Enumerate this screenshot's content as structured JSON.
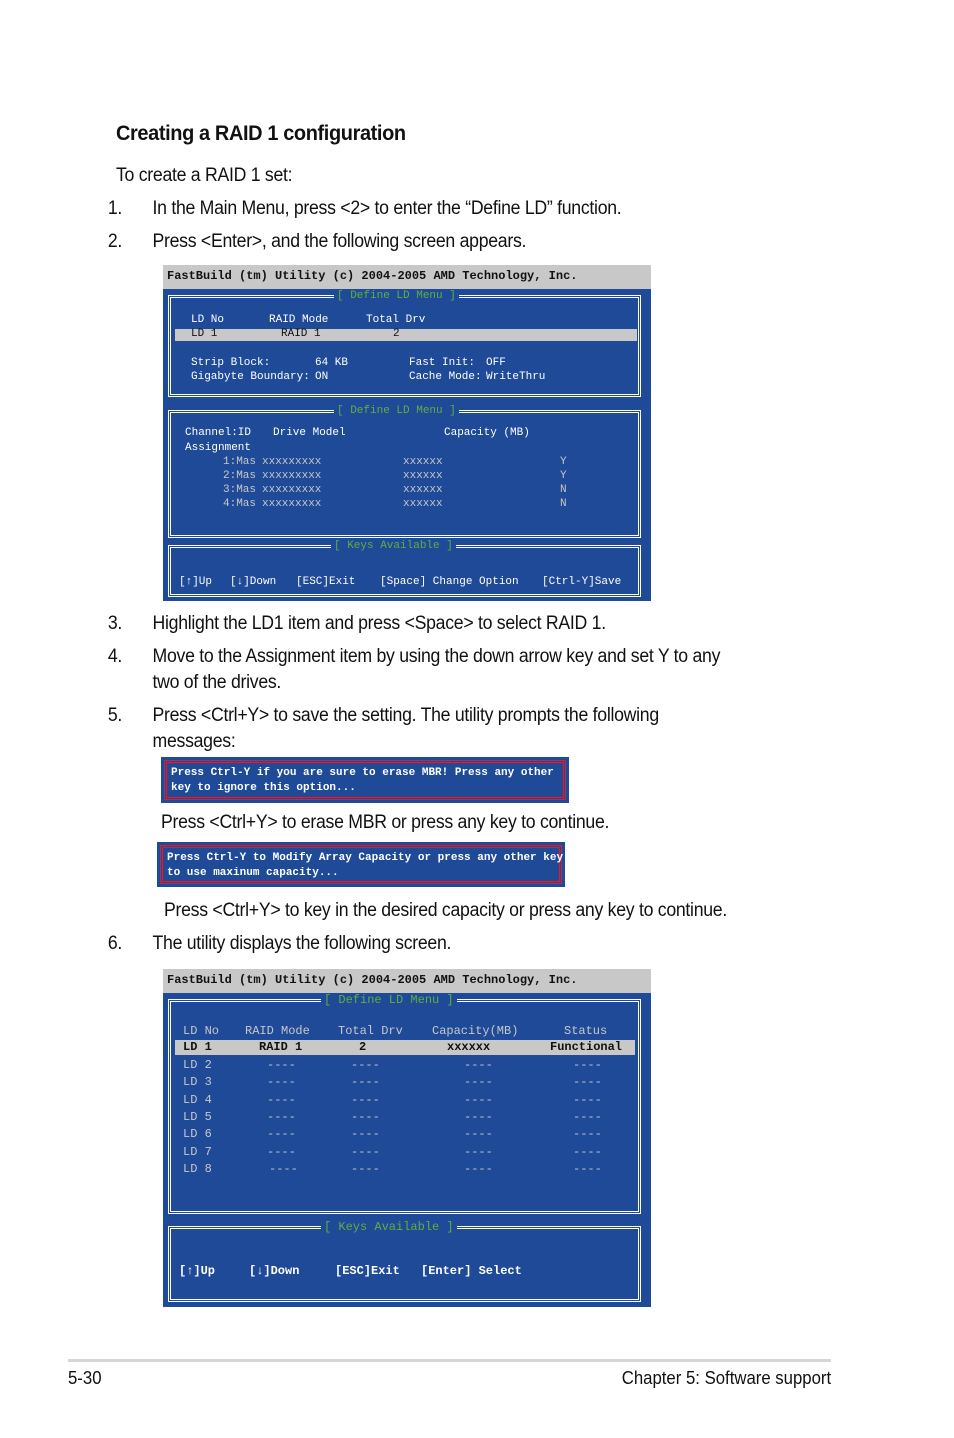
{
  "heading": "Creating a RAID 1 configuration",
  "intro": "To create a RAID 1 set:",
  "steps": [
    {
      "num": "1.",
      "text": "In the Main Menu, press <2> to enter the “Define LD” function."
    },
    {
      "num": "2.",
      "text": "Press <Enter>, and the following screen appears."
    },
    {
      "num": "3.",
      "text": "Highlight the LD1 item and press <Space> to select RAID 1."
    },
    {
      "num": "4.",
      "text": "Move to the Assignment item by using the down arrow key and set Y to any",
      "text2": "two of the drives."
    },
    {
      "num": "5.",
      "text": "Press <Ctrl+Y> to save the setting. The utility prompts the following",
      "text2": "messages:"
    },
    {
      "num": "6.",
      "text": "The utility displays the following screen."
    }
  ],
  "note_erase_mbr": "Press <Ctrl+Y> to erase MBR or press any key to continue.",
  "note_capacity": "Press <Ctrl+Y> to key in the desired capacity or press any key to continue.",
  "screen1": {
    "title": "FastBuild (tm) Utility (c) 2004-2005 AMD Technology, Inc.",
    "top_box_title": "[ Define LD Menu ]",
    "headers": {
      "ld_no": "LD No",
      "raid_mode": "RAID Mode",
      "total_drv": "Total Drv"
    },
    "selected_row": {
      "ld_no": "LD 1",
      "raid_mode": "RAID 1",
      "total_drv": "2"
    },
    "settings": {
      "strip_block_label": "Strip Block:",
      "strip_block_value": "64 KB",
      "gigabyte_boundary_label": "Gigabyte Boundary:",
      "gigabyte_boundary_value": "ON",
      "fast_init_label": "Fast Init:",
      "fast_init_value": "OFF",
      "cache_mode_label": "Cache Mode:",
      "cache_mode_value": "WriteThru"
    },
    "drive_box_title": "[ Define LD Menu ]",
    "drive_headers": {
      "channel_id": "Channel:ID",
      "drive_model": "Drive Model",
      "capacity": "Capacity (MB)",
      "assignment": "Assignment"
    },
    "drives": [
      {
        "channel": "1:Mas",
        "model": "xxxxxxxxx",
        "capacity": "xxxxxx",
        "assigned": "Y"
      },
      {
        "channel": "2:Mas",
        "model": "xxxxxxxxx",
        "capacity": "xxxxxx",
        "assigned": "Y"
      },
      {
        "channel": "3:Mas",
        "model": "xxxxxxxxx",
        "capacity": "xxxxxx",
        "assigned": "N"
      },
      {
        "channel": "4:Mas",
        "model": "xxxxxxxxx",
        "capacity": "xxxxxx",
        "assigned": "N"
      }
    ],
    "keys_title": "[ Keys Available ]",
    "keys": [
      "[↑]Up",
      "[↓]Down",
      "[ESC]Exit",
      "[Space] Change Option",
      "[Ctrl-Y]Save"
    ]
  },
  "message1": {
    "line1": "Press Ctrl-Y if you are sure to erase MBR! Press any other",
    "line2": "key to ignore this option..."
  },
  "message2": {
    "line1": "Press Ctrl-Y to Modify Array Capacity or press any other key",
    "line2": "to use maxinum capacity..."
  },
  "screen2": {
    "title": "FastBuild (tm) Utility (c) 2004-2005 AMD Technology, Inc.",
    "box_title": "[ Define LD Menu ]",
    "headers": [
      "LD No",
      "RAID Mode",
      "Total Drv",
      "Capacity(MB)",
      "Status"
    ],
    "rows": [
      [
        "LD 1",
        "RAID 1",
        "2",
        "xxxxxx",
        "Functional"
      ],
      [
        "LD 2",
        "----",
        "----",
        "----",
        "----"
      ],
      [
        "LD 3",
        "----",
        "----",
        "----",
        "----"
      ],
      [
        "LD 4",
        "----",
        "----",
        "----",
        "----"
      ],
      [
        "LD 5",
        "----",
        "----",
        "----",
        "----"
      ],
      [
        "LD 6",
        "----",
        "----",
        "----",
        "----"
      ],
      [
        "LD 7",
        "----",
        "----",
        "----",
        "----"
      ],
      [
        "LD 8",
        "----",
        "----",
        "----",
        "----"
      ]
    ],
    "keys_title": "[ Keys Available ]",
    "keys": [
      "[↑]Up",
      "[↓]Down",
      "[ESC]Exit",
      "[Enter] Select"
    ]
  },
  "footer": {
    "page": "5-30",
    "chapter": "Chapter 5: Software support"
  },
  "colors": {
    "terminal_bg": "#1f4a98",
    "title_bar": "#c8c8c8",
    "box_title_green": "#5fae3f",
    "message_border_red": "#e21c2a"
  }
}
